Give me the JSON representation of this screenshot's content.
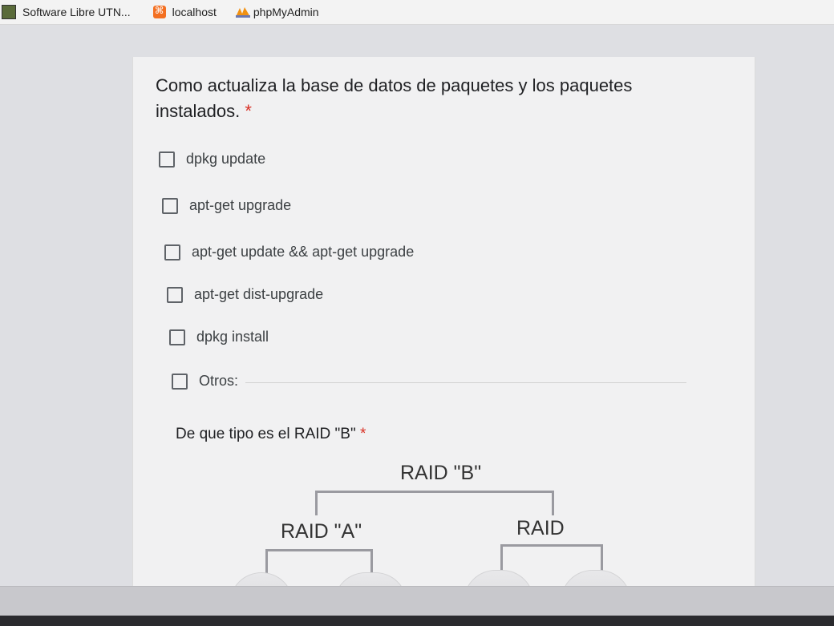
{
  "bookmarks": [
    {
      "label": "Software Libre UTN...",
      "icon": "software-libre-icon"
    },
    {
      "label": "localhost",
      "icon": "xampp-icon"
    },
    {
      "label": "phpMyAdmin",
      "icon": "phpmyadmin-icon"
    }
  ],
  "question1": {
    "title": "Como actualiza la base de datos de paquetes y los paquetes instalados.",
    "required_mark": "*",
    "options": [
      {
        "label": "dpkg update",
        "checked": false
      },
      {
        "label": "apt-get upgrade",
        "checked": false
      },
      {
        "label": "apt-get update && apt-get upgrade",
        "checked": false
      },
      {
        "label": "apt-get dist-upgrade",
        "checked": false
      },
      {
        "label": "dpkg install",
        "checked": false
      },
      {
        "label": "Otros:",
        "checked": false
      }
    ]
  },
  "question2": {
    "title": "De que tipo es el RAID \"B\"",
    "required_mark": "*",
    "diagram": {
      "top_label": "RAID \"B\"",
      "left_label": "RAID \"A\"",
      "right_label": "RAID"
    }
  },
  "colors": {
    "required": "#d93025",
    "text": "#202124",
    "card": "#f1f1f2"
  }
}
